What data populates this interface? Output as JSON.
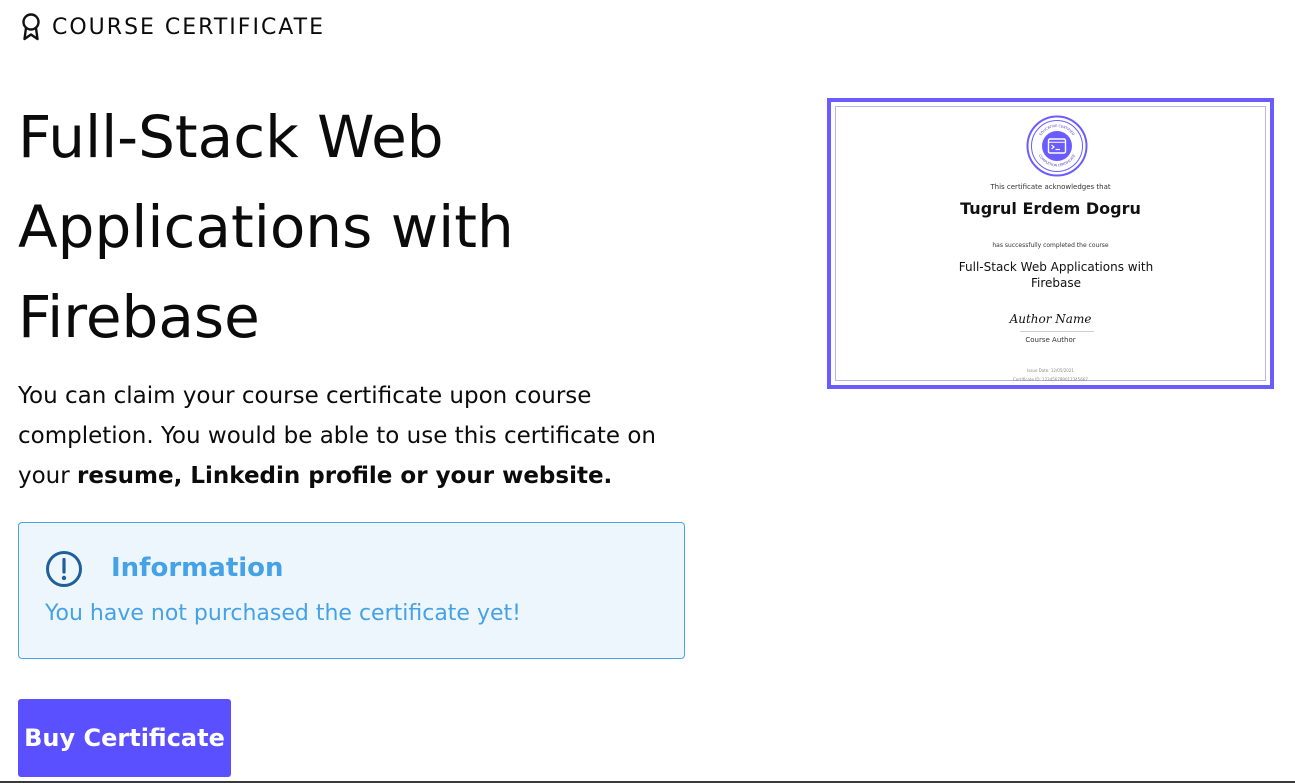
{
  "header": {
    "label": "COURSE CERTIFICATE",
    "icon": "award-ribbon-icon"
  },
  "course": {
    "title": "Full-Stack Web Applications with Firebase"
  },
  "description": {
    "text": "You can claim your course certificate upon course completion. You would be able to use this certificate on your ",
    "emphasis": "resume, Linkedin profile or your website."
  },
  "info": {
    "heading": "Information",
    "message": "You have not purchased the certificate yet!",
    "icon": "exclamation-circle-icon"
  },
  "buy_button": {
    "label": "Buy Certificate"
  },
  "certificate": {
    "seal_icon": "terminal-seal-icon",
    "seal_text_top": "EDUCATIVE CERTIFIED",
    "seal_text_bottom": "COMPLETION CERTIFICATE",
    "acknowledges": "This certificate acknowledges that",
    "recipient": "Tugrul Erdem Dogru",
    "completed": "has successfully completed the course",
    "course": "Full-Stack Web Applications with Firebase",
    "author_name": "Author Name",
    "author_role": "Course Author",
    "issue_date": "Issue Date: 12/05/2021",
    "certificate_id": "Certificate ID: 123456789012345667"
  },
  "colors": {
    "accent": "#5a50ff",
    "info_border": "#4aa4e6",
    "info_background": "#eef6fd",
    "info_text": "#45a2e6",
    "info_icon": "#1f5f9a",
    "certificate_border": "#6a5cff"
  }
}
